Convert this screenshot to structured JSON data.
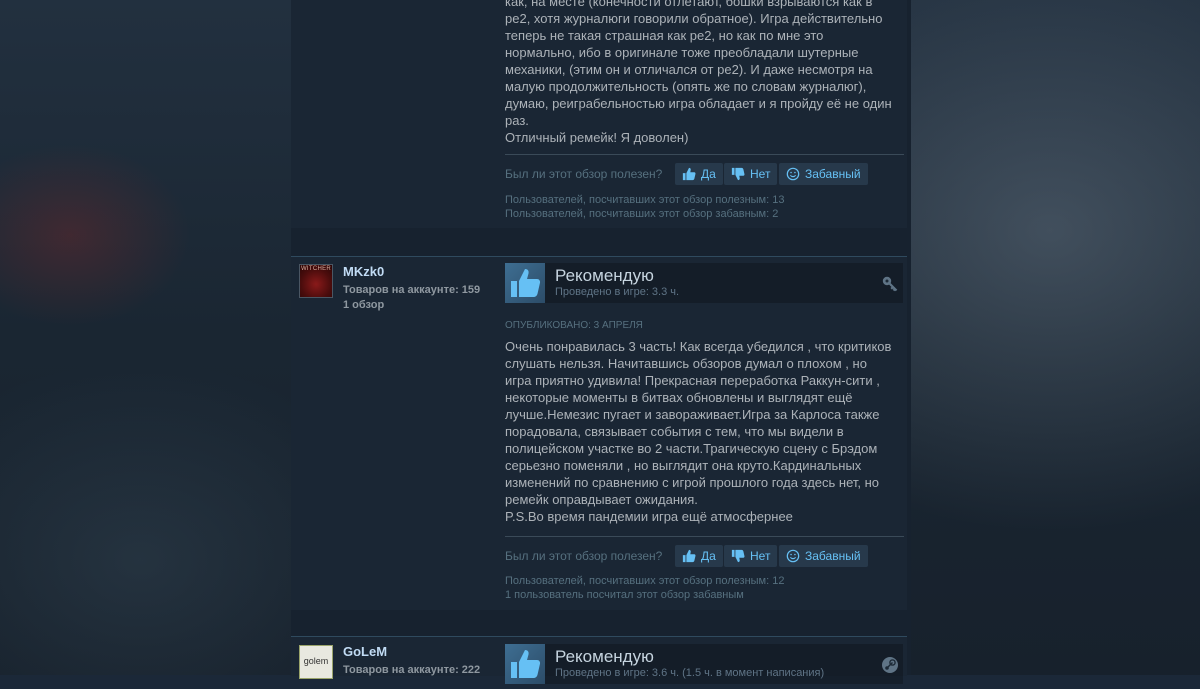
{
  "review_top": {
    "text_lines": [
      "как, на месте (конечности отлетают, бошки взрываются как в",
      "ре2, хотя журналюги говорили обратное). Игра действительно",
      "теперь не такая страшная как ре2, но как по мне это",
      "нормально, ибо в оригинале тоже преобладали шутерные",
      "механики, (этим он и отличался от ре2). И даже несмотря на",
      "малую продолжительность (опять же по словам журналюг),",
      "думаю, реиграбельностью игра обладает и я пройду её не один",
      "раз.",
      "Отличный ремейк! Я доволен)"
    ],
    "helpful_question": "Был ли этот обзор полезен?",
    "yes_label": "Да",
    "no_label": "Нет",
    "funny_label": "Забавный",
    "stat_helpful": "Пользователей, посчитавших этот обзор полезным: 13",
    "stat_funny": "Пользователей, посчитавших этот обзор забавным: 2"
  },
  "review_mid": {
    "username": "MKzk0",
    "avatar_text": "WITCHER",
    "products": "Товаров на аккаунте: 159",
    "reviews": "1 обзор",
    "verdict": "Рекомендую",
    "hours": "Проведено в игре: 3.3 ч.",
    "posted": "Опубликовано: 3 апреля",
    "text_lines": [
      "Очень понравилась 3 часть! Как всегда убедился , что критиков",
      "слушать нельзя. Начитавшись обзоров думал о плохом , но",
      "игра приятно удивила! Прекрасная переработка Раккун-сити ,",
      "некоторые моменты в битвах обновлены и выглядят ещё",
      "лучше.Немезис пугает и завораживает.Игра за Карлоса также",
      "порадовала, связывает события с тем, что мы видели в",
      "полицейском участке во 2 части.Трагическую сцену с Брэдом",
      "серьезно поменяли , но выглядит она круто.Кардинальных",
      "изменений по сравнению с игрой прошлого года здесь нет, но",
      "ремейк оправдывает ожидания.",
      "P.S.Во время пандемии игра ещё атмосфернее"
    ],
    "helpful_question": "Был ли этот обзор полезен?",
    "yes_label": "Да",
    "no_label": "Нет",
    "funny_label": "Забавный",
    "stat_helpful": "Пользователей, посчитавших этот обзор полезным: 12",
    "stat_funny": "1 пользователь посчитал этот обзор забавным"
  },
  "review_bot": {
    "username": "GoLeM",
    "avatar_text": "golem",
    "products": "Товаров на аккаунте: 222",
    "verdict": "Рекомендую",
    "hours": "Проведено в игре: 3.6 ч. (1.5 ч. в момент написания)"
  },
  "icons": {
    "thumb_up": "thumbs-up-icon",
    "thumb_down": "thumbs-down-icon",
    "funny": "smiley-icon",
    "key": "key-icon",
    "steam": "steam-icon"
  },
  "colors": {
    "link": "#66c0f4",
    "username": "#c1dbf4",
    "text": "#acb2b8",
    "muted": "#56707f"
  }
}
